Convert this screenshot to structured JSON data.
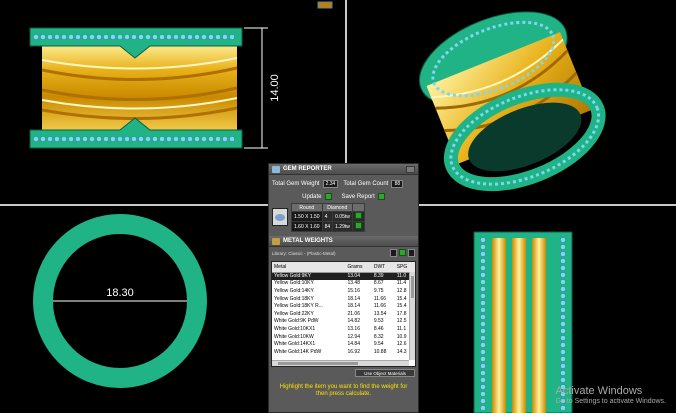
{
  "views": {
    "front_dimension": "14.00",
    "top_dimension": "18.30"
  },
  "gem_reporter": {
    "title": "GEM REPORTER",
    "total_weight_label": "Total Gem Weight",
    "total_weight_value": "2.34",
    "total_count_label": "Total Gem Count",
    "total_count_value": "88",
    "update_label": "Update",
    "save_report_label": "Save Report",
    "columns": [
      "Round",
      "Diamond"
    ],
    "rows": [
      {
        "size": "1.50 X 1.50",
        "count": "4",
        "weight": "0.05tw"
      },
      {
        "size": "1.60 X 1.60",
        "count": "84",
        "weight": "1.29tw"
      }
    ]
  },
  "metal_weights": {
    "title": "METAL WEIGHTS",
    "library": "Library: Classic - (Plastic-Metal)",
    "columns": [
      "Metal",
      "Grams",
      "DWT",
      "SPG"
    ],
    "rows": [
      {
        "metal": "Yellow Gold:9KY",
        "grams": "13.04",
        "dwt": "8.39",
        "spg": "11.0"
      },
      {
        "metal": "Yellow Gold:10KY",
        "grams": "13.48",
        "dwt": "8.67",
        "spg": "11.4"
      },
      {
        "metal": "Yellow Gold:14KY",
        "grams": "15.16",
        "dwt": "9.75",
        "spg": "12.8"
      },
      {
        "metal": "Yellow Gold:18KY",
        "grams": "18.14",
        "dwt": "11.66",
        "spg": "15.4"
      },
      {
        "metal": "Yellow Gold:18KY R...",
        "grams": "18.14",
        "dwt": "11.66",
        "spg": "15.4"
      },
      {
        "metal": "Yellow Gold:22KY",
        "grams": "21.06",
        "dwt": "13.54",
        "spg": "17.8"
      },
      {
        "metal": "White Gold:9K PdW",
        "grams": "14.82",
        "dwt": "9.53",
        "spg": "12.5"
      },
      {
        "metal": "White Gold:10KX1",
        "grams": "13.16",
        "dwt": "8.46",
        "spg": "11.1"
      },
      {
        "metal": "White Gold:10KW",
        "grams": "12.94",
        "dwt": "8.32",
        "spg": "10.9"
      },
      {
        "metal": "White Gold:14KX1",
        "grams": "14.84",
        "dwt": "9.54",
        "spg": "12.6"
      },
      {
        "metal": "White Gold:14K PdW",
        "grams": "16.92",
        "dwt": "10.88",
        "spg": "14.3"
      }
    ],
    "selected_row": 0,
    "object_dropdown": "Use Object Materials",
    "hint": "Highlight the item you want to find the weight for then press calculate."
  },
  "watermark": {
    "title": "Activate Windows",
    "subtitle": "Go to Settings to activate Windows."
  },
  "colors": {
    "gold": "#e8b21a",
    "teal": "#1fb386",
    "gem": "#7fd6f0",
    "hint_yellow": "#ffe000"
  }
}
